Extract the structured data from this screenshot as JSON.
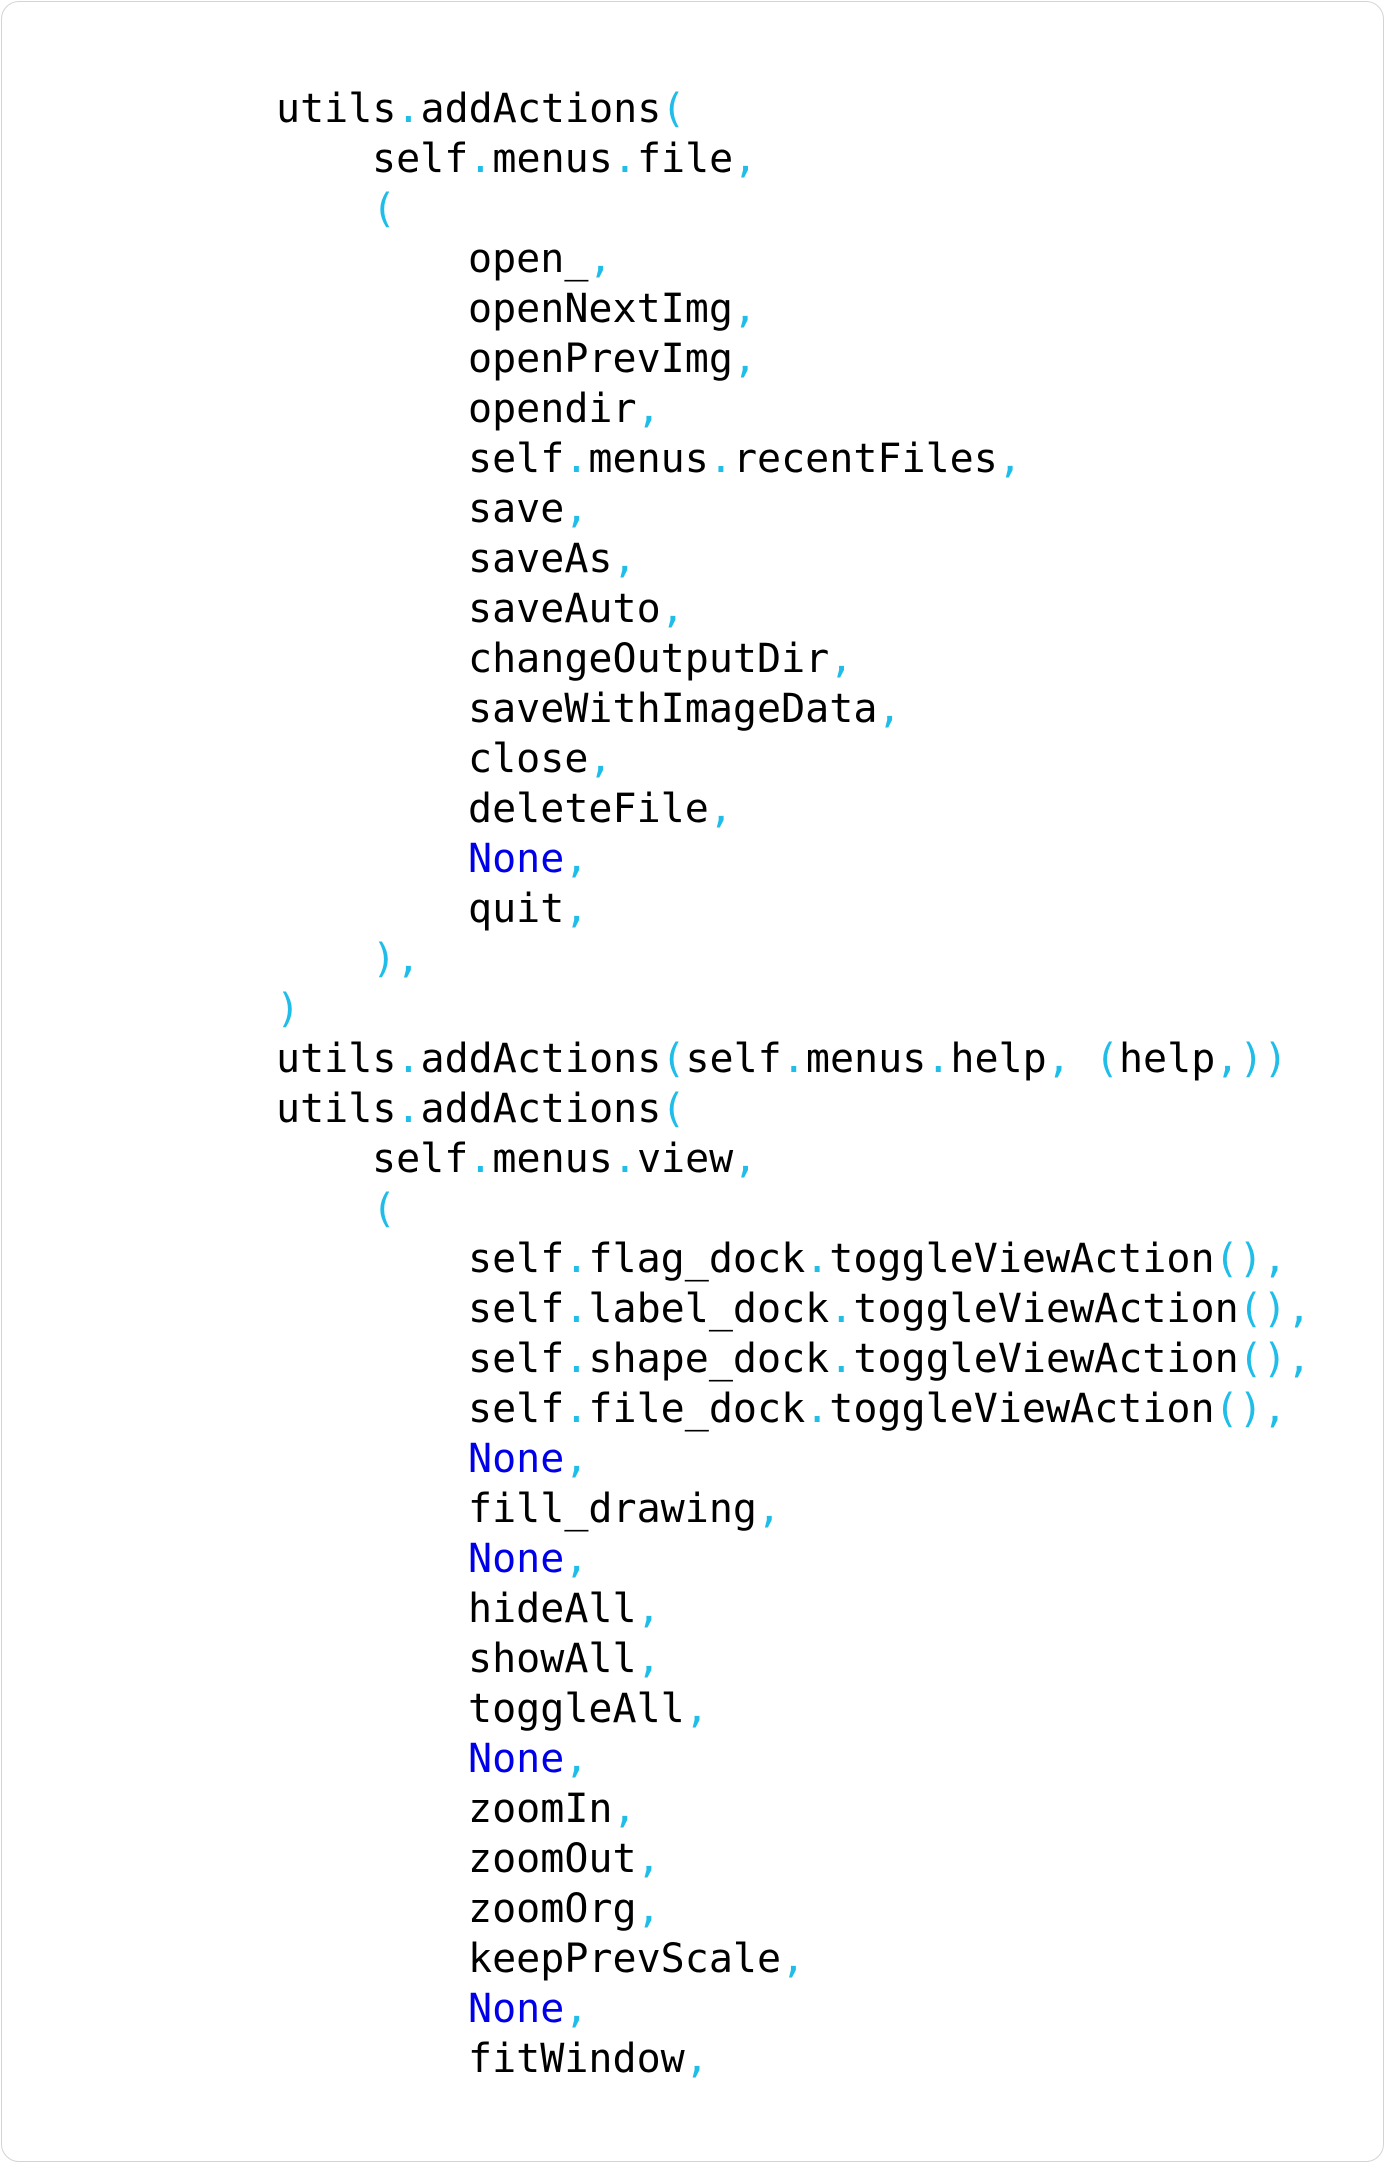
{
  "colors": {
    "identifier": "#000000",
    "punctuation": "#1fbde8",
    "keyword": "#0000e8",
    "background": "#ffffff",
    "border": "#d4d4d4"
  },
  "code": {
    "lines": [
      {
        "indent": 2,
        "tokens": [
          {
            "t": "utils",
            "k": "id"
          },
          {
            "t": ".",
            "k": "p"
          },
          {
            "t": "addActions",
            "k": "id"
          },
          {
            "t": "(",
            "k": "p"
          }
        ]
      },
      {
        "indent": 3,
        "tokens": [
          {
            "t": "self",
            "k": "id"
          },
          {
            "t": ".",
            "k": "p"
          },
          {
            "t": "menus",
            "k": "id"
          },
          {
            "t": ".",
            "k": "p"
          },
          {
            "t": "file",
            "k": "id"
          },
          {
            "t": ",",
            "k": "p"
          }
        ]
      },
      {
        "indent": 3,
        "tokens": [
          {
            "t": "(",
            "k": "p"
          }
        ]
      },
      {
        "indent": 4,
        "tokens": [
          {
            "t": "open_",
            "k": "id"
          },
          {
            "t": ",",
            "k": "p"
          }
        ]
      },
      {
        "indent": 4,
        "tokens": [
          {
            "t": "openNextImg",
            "k": "id"
          },
          {
            "t": ",",
            "k": "p"
          }
        ]
      },
      {
        "indent": 4,
        "tokens": [
          {
            "t": "openPrevImg",
            "k": "id"
          },
          {
            "t": ",",
            "k": "p"
          }
        ]
      },
      {
        "indent": 4,
        "tokens": [
          {
            "t": "opendir",
            "k": "id"
          },
          {
            "t": ",",
            "k": "p"
          }
        ]
      },
      {
        "indent": 4,
        "tokens": [
          {
            "t": "self",
            "k": "id"
          },
          {
            "t": ".",
            "k": "p"
          },
          {
            "t": "menus",
            "k": "id"
          },
          {
            "t": ".",
            "k": "p"
          },
          {
            "t": "recentFiles",
            "k": "id"
          },
          {
            "t": ",",
            "k": "p"
          }
        ]
      },
      {
        "indent": 4,
        "tokens": [
          {
            "t": "save",
            "k": "id"
          },
          {
            "t": ",",
            "k": "p"
          }
        ]
      },
      {
        "indent": 4,
        "tokens": [
          {
            "t": "saveAs",
            "k": "id"
          },
          {
            "t": ",",
            "k": "p"
          }
        ]
      },
      {
        "indent": 4,
        "tokens": [
          {
            "t": "saveAuto",
            "k": "id"
          },
          {
            "t": ",",
            "k": "p"
          }
        ]
      },
      {
        "indent": 4,
        "tokens": [
          {
            "t": "changeOutputDir",
            "k": "id"
          },
          {
            "t": ",",
            "k": "p"
          }
        ]
      },
      {
        "indent": 4,
        "tokens": [
          {
            "t": "saveWithImageData",
            "k": "id"
          },
          {
            "t": ",",
            "k": "p"
          }
        ]
      },
      {
        "indent": 4,
        "tokens": [
          {
            "t": "close",
            "k": "id"
          },
          {
            "t": ",",
            "k": "p"
          }
        ]
      },
      {
        "indent": 4,
        "tokens": [
          {
            "t": "deleteFile",
            "k": "id"
          },
          {
            "t": ",",
            "k": "p"
          }
        ]
      },
      {
        "indent": 4,
        "tokens": [
          {
            "t": "None",
            "k": "kw"
          },
          {
            "t": ",",
            "k": "p"
          }
        ]
      },
      {
        "indent": 4,
        "tokens": [
          {
            "t": "quit",
            "k": "id"
          },
          {
            "t": ",",
            "k": "p"
          }
        ]
      },
      {
        "indent": 3,
        "tokens": [
          {
            "t": "),",
            "k": "p"
          }
        ]
      },
      {
        "indent": 2,
        "tokens": [
          {
            "t": ")",
            "k": "p"
          }
        ]
      },
      {
        "indent": 2,
        "tokens": [
          {
            "t": "utils",
            "k": "id"
          },
          {
            "t": ".",
            "k": "p"
          },
          {
            "t": "addActions",
            "k": "id"
          },
          {
            "t": "(",
            "k": "p"
          },
          {
            "t": "self",
            "k": "id"
          },
          {
            "t": ".",
            "k": "p"
          },
          {
            "t": "menus",
            "k": "id"
          },
          {
            "t": ".",
            "k": "p"
          },
          {
            "t": "help",
            "k": "id"
          },
          {
            "t": ", (",
            "k": "p"
          },
          {
            "t": "help",
            "k": "id"
          },
          {
            "t": ",))",
            "k": "p"
          }
        ]
      },
      {
        "indent": 2,
        "tokens": [
          {
            "t": "utils",
            "k": "id"
          },
          {
            "t": ".",
            "k": "p"
          },
          {
            "t": "addActions",
            "k": "id"
          },
          {
            "t": "(",
            "k": "p"
          }
        ]
      },
      {
        "indent": 3,
        "tokens": [
          {
            "t": "self",
            "k": "id"
          },
          {
            "t": ".",
            "k": "p"
          },
          {
            "t": "menus",
            "k": "id"
          },
          {
            "t": ".",
            "k": "p"
          },
          {
            "t": "view",
            "k": "id"
          },
          {
            "t": ",",
            "k": "p"
          }
        ]
      },
      {
        "indent": 3,
        "tokens": [
          {
            "t": "(",
            "k": "p"
          }
        ]
      },
      {
        "indent": 4,
        "tokens": [
          {
            "t": "self",
            "k": "id"
          },
          {
            "t": ".",
            "k": "p"
          },
          {
            "t": "flag_dock",
            "k": "id"
          },
          {
            "t": ".",
            "k": "p"
          },
          {
            "t": "toggleViewAction",
            "k": "id"
          },
          {
            "t": "(),",
            "k": "p"
          }
        ]
      },
      {
        "indent": 4,
        "tokens": [
          {
            "t": "self",
            "k": "id"
          },
          {
            "t": ".",
            "k": "p"
          },
          {
            "t": "label_dock",
            "k": "id"
          },
          {
            "t": ".",
            "k": "p"
          },
          {
            "t": "toggleViewAction",
            "k": "id"
          },
          {
            "t": "(),",
            "k": "p"
          }
        ]
      },
      {
        "indent": 4,
        "tokens": [
          {
            "t": "self",
            "k": "id"
          },
          {
            "t": ".",
            "k": "p"
          },
          {
            "t": "shape_dock",
            "k": "id"
          },
          {
            "t": ".",
            "k": "p"
          },
          {
            "t": "toggleViewAction",
            "k": "id"
          },
          {
            "t": "(),",
            "k": "p"
          }
        ]
      },
      {
        "indent": 4,
        "tokens": [
          {
            "t": "self",
            "k": "id"
          },
          {
            "t": ".",
            "k": "p"
          },
          {
            "t": "file_dock",
            "k": "id"
          },
          {
            "t": ".",
            "k": "p"
          },
          {
            "t": "toggleViewAction",
            "k": "id"
          },
          {
            "t": "(),",
            "k": "p"
          }
        ]
      },
      {
        "indent": 4,
        "tokens": [
          {
            "t": "None",
            "k": "kw"
          },
          {
            "t": ",",
            "k": "p"
          }
        ]
      },
      {
        "indent": 4,
        "tokens": [
          {
            "t": "fill_drawing",
            "k": "id"
          },
          {
            "t": ",",
            "k": "p"
          }
        ]
      },
      {
        "indent": 4,
        "tokens": [
          {
            "t": "None",
            "k": "kw"
          },
          {
            "t": ",",
            "k": "p"
          }
        ]
      },
      {
        "indent": 4,
        "tokens": [
          {
            "t": "hideAll",
            "k": "id"
          },
          {
            "t": ",",
            "k": "p"
          }
        ]
      },
      {
        "indent": 4,
        "tokens": [
          {
            "t": "showAll",
            "k": "id"
          },
          {
            "t": ",",
            "k": "p"
          }
        ]
      },
      {
        "indent": 4,
        "tokens": [
          {
            "t": "toggleAll",
            "k": "id"
          },
          {
            "t": ",",
            "k": "p"
          }
        ]
      },
      {
        "indent": 4,
        "tokens": [
          {
            "t": "None",
            "k": "kw"
          },
          {
            "t": ",",
            "k": "p"
          }
        ]
      },
      {
        "indent": 4,
        "tokens": [
          {
            "t": "zoomIn",
            "k": "id"
          },
          {
            "t": ",",
            "k": "p"
          }
        ]
      },
      {
        "indent": 4,
        "tokens": [
          {
            "t": "zoomOut",
            "k": "id"
          },
          {
            "t": ",",
            "k": "p"
          }
        ]
      },
      {
        "indent": 4,
        "tokens": [
          {
            "t": "zoomOrg",
            "k": "id"
          },
          {
            "t": ",",
            "k": "p"
          }
        ]
      },
      {
        "indent": 4,
        "tokens": [
          {
            "t": "keepPrevScale",
            "k": "id"
          },
          {
            "t": ",",
            "k": "p"
          }
        ]
      },
      {
        "indent": 4,
        "tokens": [
          {
            "t": "None",
            "k": "kw"
          },
          {
            "t": ",",
            "k": "p"
          }
        ]
      },
      {
        "indent": 4,
        "tokens": [
          {
            "t": "fitWindow",
            "k": "id"
          },
          {
            "t": ",",
            "k": "p"
          }
        ]
      }
    ]
  }
}
